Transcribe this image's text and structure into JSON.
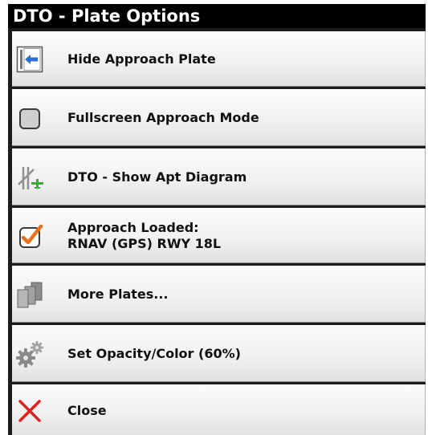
{
  "window": {
    "title": "DTO - Plate Options"
  },
  "menu": {
    "hide_approach_plate": {
      "label": "Hide Approach Plate",
      "icon": "hide-plate-icon"
    },
    "fullscreen_mode": {
      "label": "Fullscreen Approach Mode",
      "icon": "checkbox-unchecked-icon",
      "checked": false
    },
    "show_apt_diagram": {
      "label": "DTO - Show Apt Diagram",
      "icon": "runway-diagram-icon"
    },
    "approach_loaded": {
      "line1": "Approach Loaded:",
      "line2": "RNAV (GPS) RWY 18L",
      "icon": "checkbox-checked-icon",
      "checked": true
    },
    "more_plates": {
      "label": "More Plates...",
      "icon": "plates-stack-icon"
    },
    "opacity_color": {
      "label": "Set Opacity/Color (60%)",
      "icon": "gears-icon"
    },
    "close": {
      "label": "Close",
      "icon": "close-icon"
    }
  },
  "colors": {
    "title_bar": "#000000",
    "accent_blue": "#2a6fd6",
    "check_orange": "#e8701f",
    "close_red": "#e02020",
    "plane_green": "#2bb52b"
  }
}
